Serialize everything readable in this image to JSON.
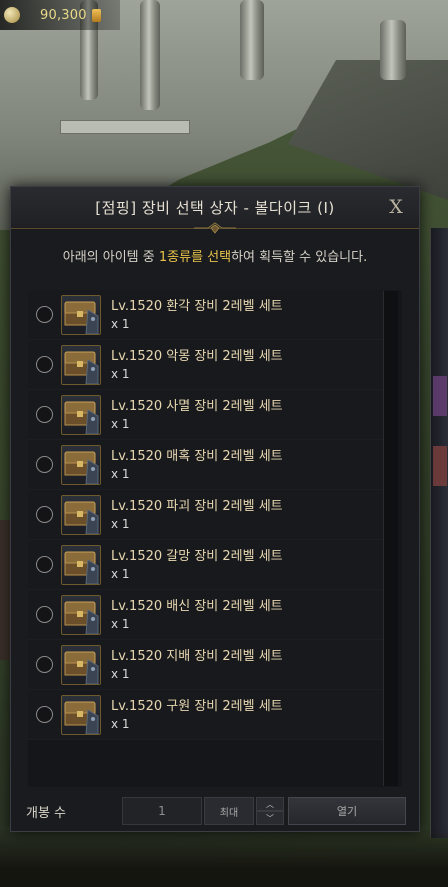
{
  "currency": {
    "amount": "90,300",
    "gem_icon": "pheon-icon",
    "coin_icon": "gold-coin-icon"
  },
  "dialog": {
    "title": "[점핑] 장비 선택 상자 - 볼다이크 (I)",
    "close_label": "X",
    "description_before": "아래의 아이템 중 ",
    "description_highlight": "1종류를 선택",
    "description_after": "하여 획득할 수 있습니다.",
    "highlight_color": "#e8c34a",
    "items": [
      {
        "name": "Lv.1520 환각 장비 2레벨 세트",
        "qty": "x 1"
      },
      {
        "name": "Lv.1520 악몽 장비 2레벨 세트",
        "qty": "x 1"
      },
      {
        "name": "Lv.1520 사멸 장비 2레벨 세트",
        "qty": "x 1"
      },
      {
        "name": "Lv.1520 매혹 장비 2레벨 세트",
        "qty": "x 1"
      },
      {
        "name": "Lv.1520 파괴 장비 2레벨 세트",
        "qty": "x 1"
      },
      {
        "name": "Lv.1520 갈망 장비 2레벨 세트",
        "qty": "x 1"
      },
      {
        "name": "Lv.1520 배신 장비 2레벨 세트",
        "qty": "x 1"
      },
      {
        "name": "Lv.1520 지배 장비 2레벨 세트",
        "qty": "x 1"
      },
      {
        "name": "Lv.1520 구원 장비 2레벨 세트",
        "qty": "x 1"
      }
    ],
    "footer": {
      "label": "개봉 수",
      "quantity": "1",
      "max_label": "최대",
      "up_icon": "chevron-up-icon",
      "down_icon": "chevron-down-icon",
      "open_label": "열기"
    }
  }
}
